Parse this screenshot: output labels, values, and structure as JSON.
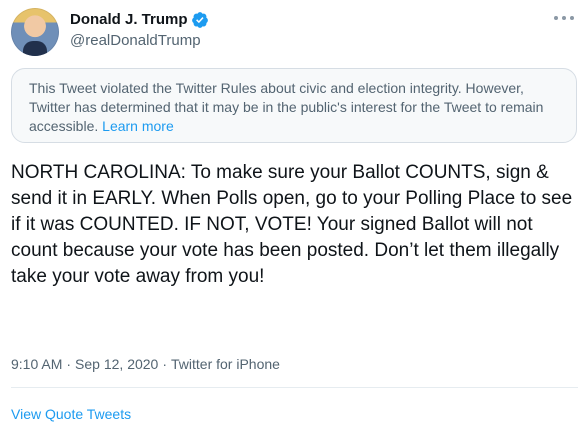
{
  "user": {
    "display_name": "Donald J. Trump",
    "handle": "@realDonaldTrump"
  },
  "icons": {
    "verified": "verified-check-icon",
    "more": "more-options-icon"
  },
  "notice": {
    "text": "This Tweet violated the Twitter Rules about civic and election integrity. However, Twitter has determined that it may be in the public's interest for the Tweet to remain accessible.",
    "link": "Learn more"
  },
  "tweet": {
    "text": "NORTH CAROLINA: To make sure your Ballot COUNTS, sign & send it in EARLY. When Polls open, go to your Polling Place to see if it was COUNTED. IF NOT, VOTE! Your signed Ballot will not count because your vote has been posted. Don’t let them illegally take your vote away from you!",
    "time": "9:10 AM",
    "separator": "·",
    "date": "Sep 12, 2020",
    "source": "Twitter for iPhone"
  },
  "actions": {
    "view_quote_tweets": "View Quote Tweets"
  },
  "colors": {
    "accent": "#1d9bf0",
    "secondary_text": "#536471",
    "notice_background": "#f7f9fa"
  }
}
